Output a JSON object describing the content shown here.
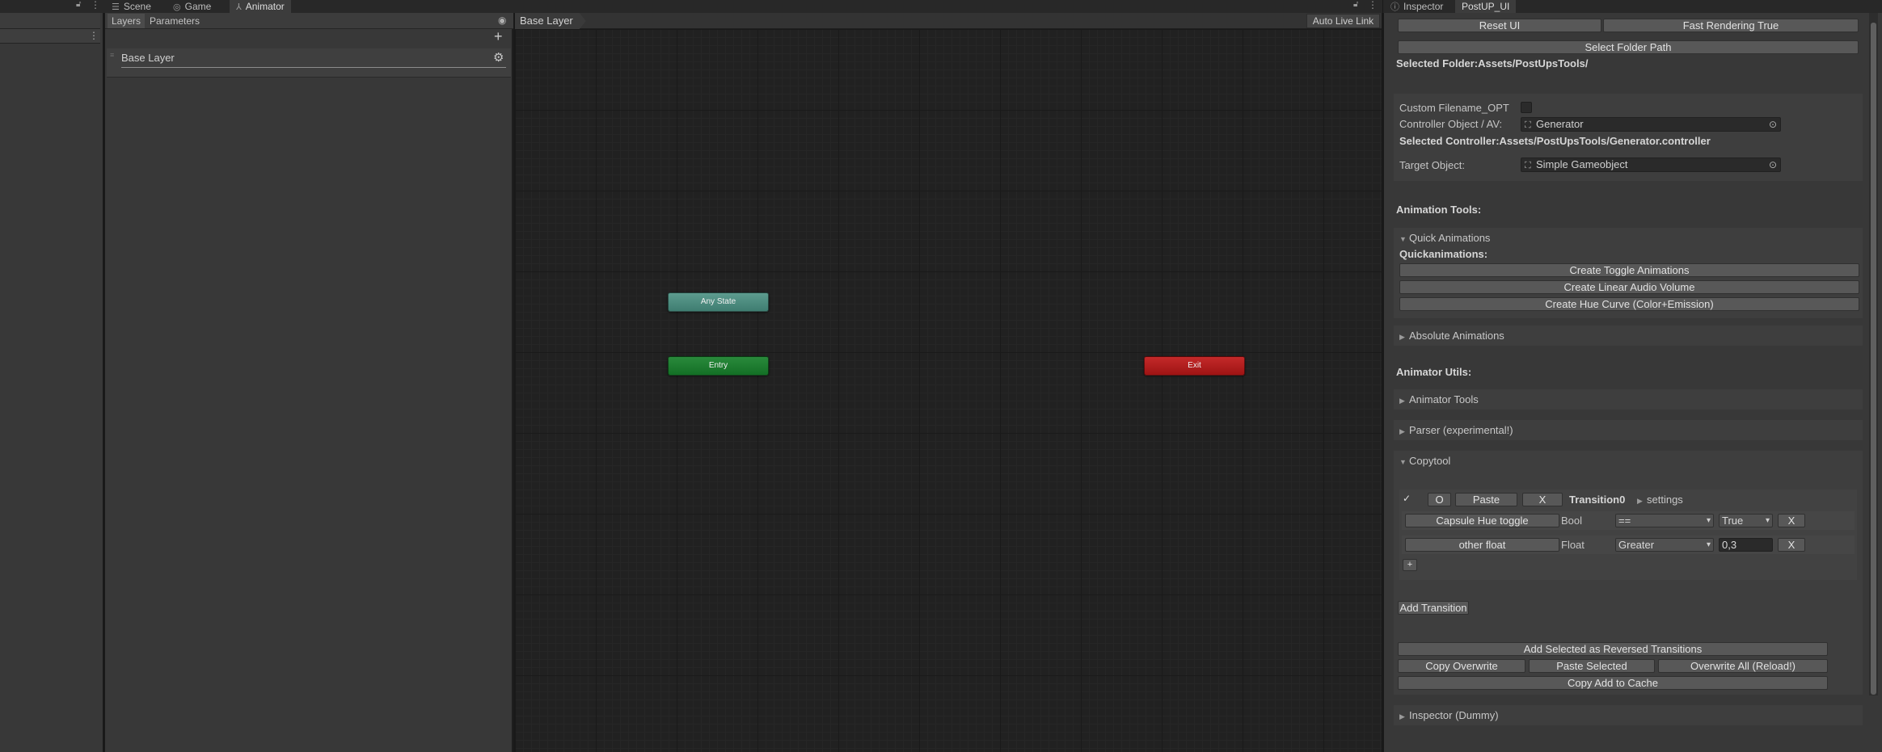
{
  "tabs": {
    "scene": "Scene",
    "game": "Game",
    "animator": "Animator",
    "inspector": "Inspector",
    "postup": "PostUP_UI"
  },
  "icons": {
    "scene": "hamburger-icon",
    "game": "gamepad-icon",
    "animator": "animator-icon",
    "inspector": "info-icon",
    "lock": "lock-icon",
    "menu": "kebab-menu-icon",
    "eye": "eye-icon",
    "add": "plus-icon",
    "gear": "gear-icon"
  },
  "animator": {
    "toolbar": {
      "layers_tab": "Layers",
      "parameters_tab": "Parameters"
    },
    "layer_name": "Base Layer",
    "breadcrumb": "Base Layer",
    "auto_live_link": "Auto Live Link",
    "states": {
      "any": "Any State",
      "entry": "Entry",
      "exit": "Exit"
    },
    "colors": {
      "any": "#4f8d80",
      "entry": "#1c7c2e",
      "exit": "#b01e1e"
    }
  },
  "inspector": {
    "reset_ui": "Reset UI",
    "fast_rendering": "Fast Rendering True",
    "select_folder": "Select Folder Path",
    "selected_folder": "Selected Folder:Assets/PostUpsTools/",
    "custom_filename_label": "Custom Filename_OPT",
    "controller_label": "Controller Object / AV:",
    "controller_value": "Generator",
    "selected_controller": "Selected Controller:Assets/PostUpsTools/Generator.controller",
    "target_label": "Target Object:",
    "target_value": "Simple Gameobject",
    "animation_tools_header": "Animation Tools:",
    "quick_animations_foldout": "Quick Animations",
    "quickanimations_label": "Quickanimations:",
    "create_toggle": "Create Toggle Animations",
    "create_linear_audio": "Create Linear Audio Volume",
    "create_hue_curve": "Create Hue Curve (Color+Emission)",
    "absolute_animations_foldout": "Absolute Animations",
    "animator_utils_header": "Animator Utils:",
    "animator_tools_foldout": "Animator Tools",
    "parser_foldout": "Parser (experimental!)",
    "copytool_foldout": "Copytool",
    "copytool": {
      "check": "✓",
      "o_button": "O",
      "paste_button": "Paste",
      "x_button": "X",
      "transition_name": "Transition0",
      "settings_foldout": "settings",
      "conditions": [
        {
          "param": "Capsule Hue toggle",
          "type": "Bool",
          "op": "==",
          "value": "True",
          "remove": "X"
        },
        {
          "param": "other float",
          "type": "Float",
          "op": "Greater",
          "value": "0,3",
          "remove": "X"
        }
      ],
      "add_condition": "+",
      "add_transition": "Add Transition"
    },
    "add_reversed": "Add Selected as Reversed Transitions",
    "copy_overwrite": "Copy Overwrite",
    "paste_selected": "Paste Selected",
    "overwrite_all": "Overwrite All (Reload!)",
    "copy_add_cache": "Copy Add to Cache",
    "inspector_dummy_foldout": "Inspector (Dummy)"
  }
}
